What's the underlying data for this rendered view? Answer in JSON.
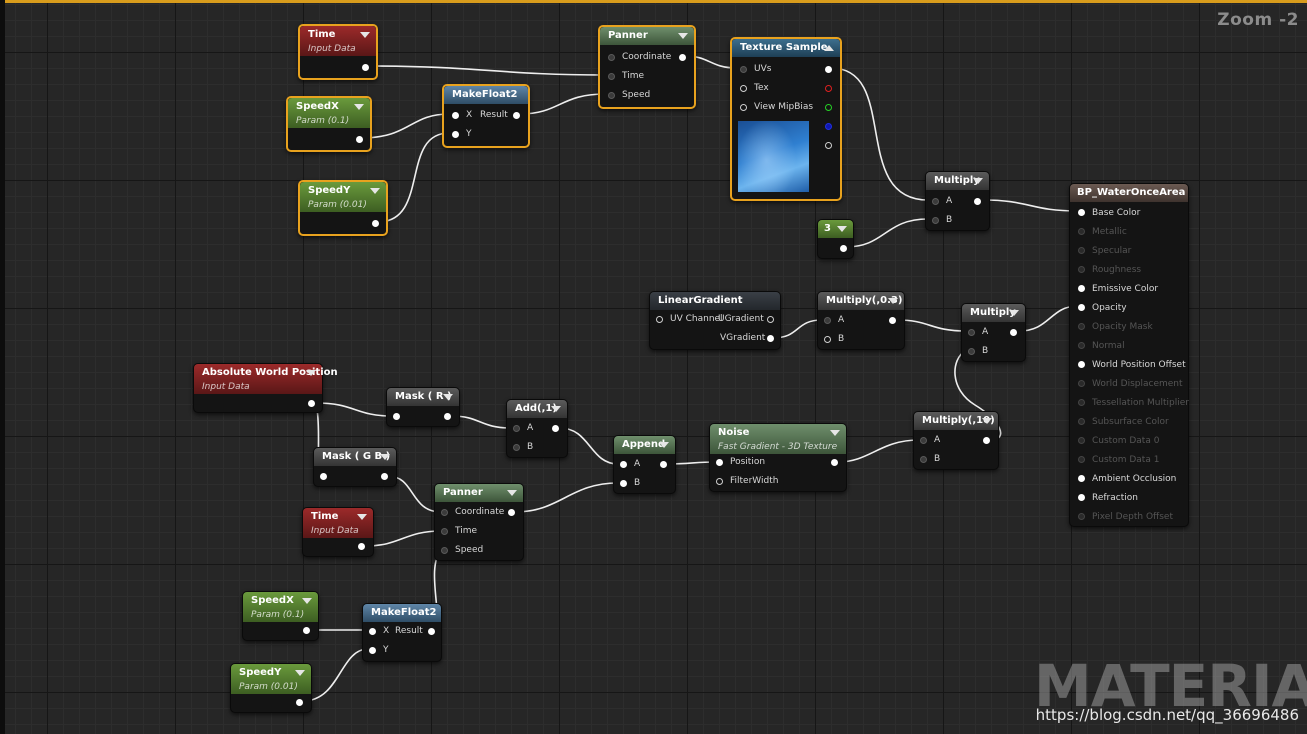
{
  "editor": {
    "zoom": "Zoom -2",
    "watermark": "MATERIAL",
    "url": "https://blog.csdn.net/qq_36696486"
  },
  "colors": {
    "selection": "#e8a21e",
    "input_data_header": "#9c2a2a",
    "param_header": "#6a9a3c",
    "wire": "#ffffff",
    "tex_pin_r": "#e02020",
    "tex_pin_g": "#25d025",
    "tex_pin_b": "#2030e0"
  },
  "nodes": {
    "time1": {
      "title": "Time",
      "subtitle": "Input Data"
    },
    "speedx1": {
      "title": "SpeedX",
      "subtitle": "Param (0.1)"
    },
    "speedy1": {
      "title": "SpeedY",
      "subtitle": "Param (0.01)"
    },
    "makefloat1": {
      "title": "MakeFloat2",
      "pins": [
        "X",
        "Y",
        "Result"
      ]
    },
    "panner1": {
      "title": "Panner",
      "pins": [
        "Coordinate",
        "Time",
        "Speed"
      ]
    },
    "texsample": {
      "title": "Texture Sample",
      "pins": [
        "UVs",
        "Tex",
        "View MipBias"
      ]
    },
    "multiply1": {
      "title": "Multiply",
      "pins": [
        "A",
        "B"
      ]
    },
    "const3": {
      "title": "3"
    },
    "output": {
      "title": "BP_WaterOnceArea",
      "pins": [
        {
          "label": "Base Color",
          "active": true
        },
        {
          "label": "Metallic",
          "active": false
        },
        {
          "label": "Specular",
          "active": false
        },
        {
          "label": "Roughness",
          "active": false
        },
        {
          "label": "Emissive Color",
          "active": true
        },
        {
          "label": "Opacity",
          "active": true
        },
        {
          "label": "Opacity Mask",
          "active": false
        },
        {
          "label": "Normal",
          "active": false
        },
        {
          "label": "World Position Offset",
          "active": true
        },
        {
          "label": "World Displacement",
          "active": false
        },
        {
          "label": "Tessellation Multiplier",
          "active": false
        },
        {
          "label": "Subsurface Color",
          "active": false
        },
        {
          "label": "Custom Data 0",
          "active": false
        },
        {
          "label": "Custom Data 1",
          "active": false
        },
        {
          "label": "Ambient Occlusion",
          "active": true
        },
        {
          "label": "Refraction",
          "active": true
        },
        {
          "label": "Pixel Depth Offset",
          "active": false
        }
      ]
    },
    "lineargrad": {
      "title": "LinearGradient",
      "pins": [
        "UV Channel",
        "UGradient",
        "VGradient"
      ]
    },
    "multiply03": {
      "title": "Multiply(,0.3)",
      "pins": [
        "A",
        "B"
      ]
    },
    "multiply2": {
      "title": "Multiply",
      "pins": [
        "A",
        "B"
      ]
    },
    "absworld": {
      "title": "Absolute World Position",
      "subtitle": "Input Data"
    },
    "maskr": {
      "title": "Mask ( R )"
    },
    "add1": {
      "title": "Add(,1)",
      "pins": [
        "A",
        "B"
      ]
    },
    "maskgb": {
      "title": "Mask ( G B )"
    },
    "append": {
      "title": "Append",
      "pins": [
        "A",
        "B"
      ]
    },
    "noise": {
      "title": "Noise",
      "subtitle": "Fast Gradient - 3D Texture",
      "pins": [
        "Position",
        "FilterWidth"
      ]
    },
    "multiply10": {
      "title": "Multiply(,10)",
      "pins": [
        "A",
        "B"
      ]
    },
    "panner2": {
      "title": "Panner",
      "pins": [
        "Coordinate",
        "Time",
        "Speed"
      ]
    },
    "time2": {
      "title": "Time",
      "subtitle": "Input Data"
    },
    "speedx2": {
      "title": "SpeedX",
      "subtitle": "Param (0.1)"
    },
    "speedy2": {
      "title": "SpeedY",
      "subtitle": "Param (0.01)"
    },
    "makefloat2": {
      "title": "MakeFloat2",
      "pins": [
        "X",
        "Y",
        "Result"
      ]
    }
  }
}
